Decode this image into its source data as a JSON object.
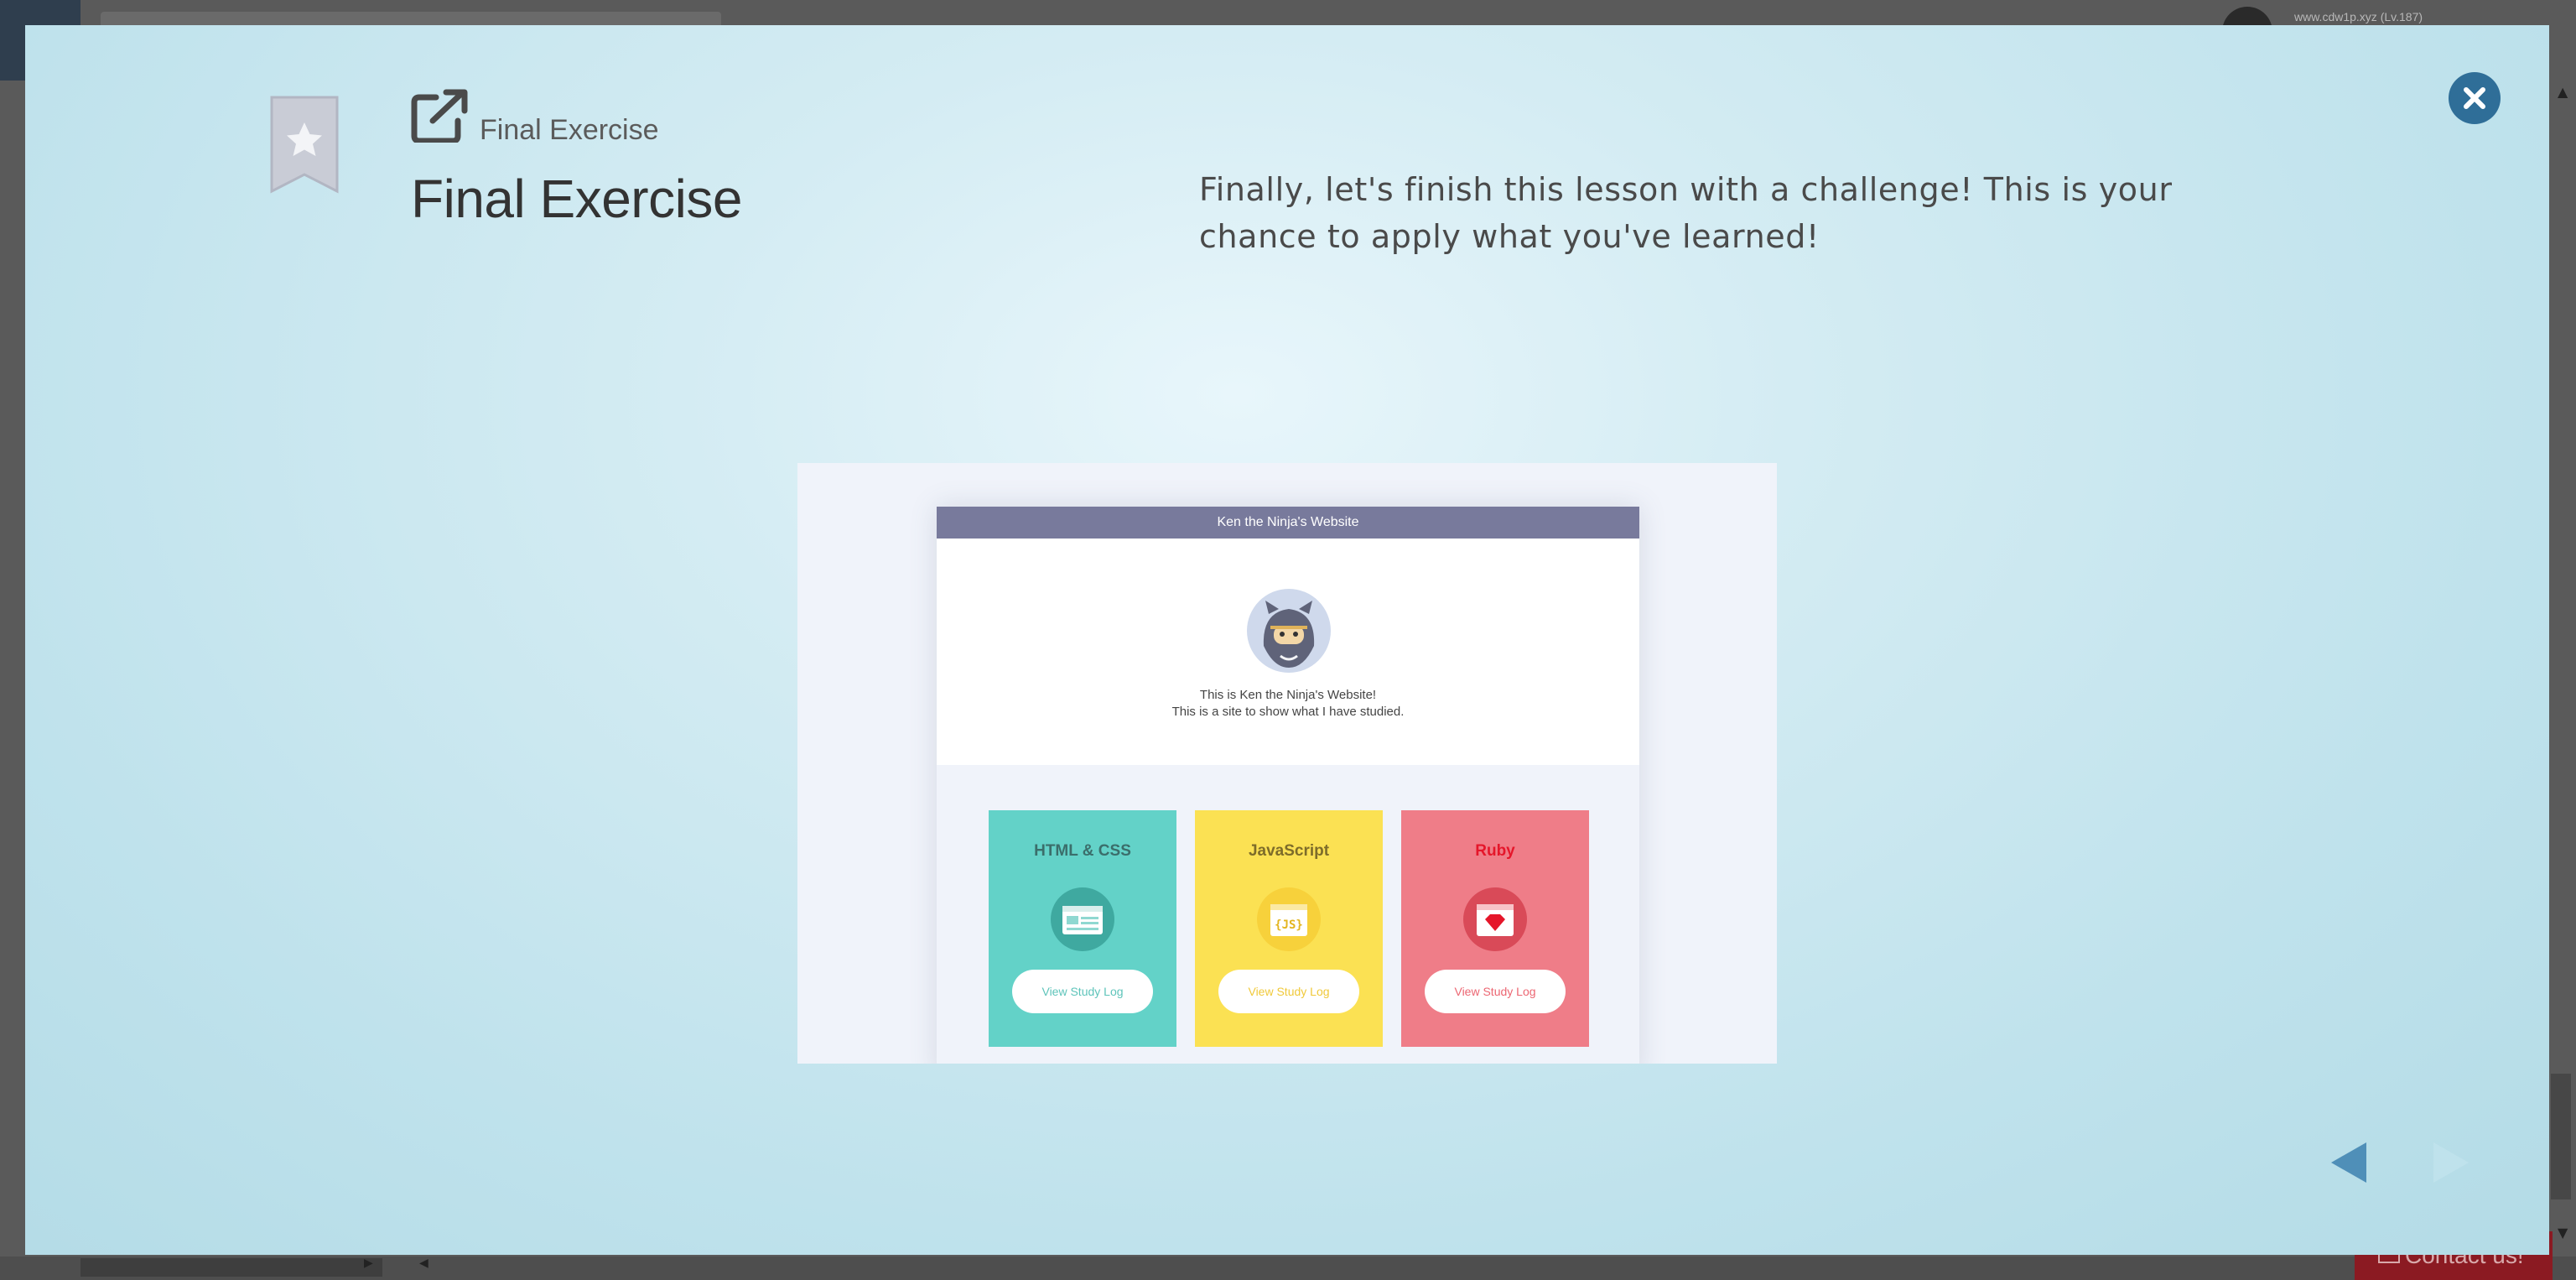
{
  "background": {
    "user_text": "www.cdw1p.xyz (Lv.187)",
    "contact_label": "Contact us!"
  },
  "modal": {
    "subtitle": "Final Exercise",
    "title": "Final Exercise",
    "description": "Finally, let's finish this lesson with a challenge! This is your chance to apply what you've learned!",
    "close_icon": "close-icon",
    "bookmark_icon": "star-bookmark-icon",
    "external_link_icon": "external-link-icon"
  },
  "illustration": {
    "site_title": "Ken the Ninja's Website",
    "hero_line1": "This is Ken the Ninja's Website!",
    "hero_line2": "This is a site to show what I have studied.",
    "cards": [
      {
        "title": "HTML & CSS",
        "button": "View Study Log",
        "color": "#63d2c8"
      },
      {
        "title": "JavaScript",
        "button": "View Study Log",
        "color": "#fbe153"
      },
      {
        "title": "Ruby",
        "button": "View Study Log",
        "color": "#ef7d88"
      }
    ],
    "js_badge_text": "{JS}"
  },
  "navigation": {
    "prev_icon": "triangle-left-icon",
    "next_icon": "triangle-right-icon",
    "next_enabled": false
  },
  "colors": {
    "accent": "#2f6e98",
    "modal_bg": "#d4ecf3",
    "contact_bg": "#8b1a22"
  }
}
